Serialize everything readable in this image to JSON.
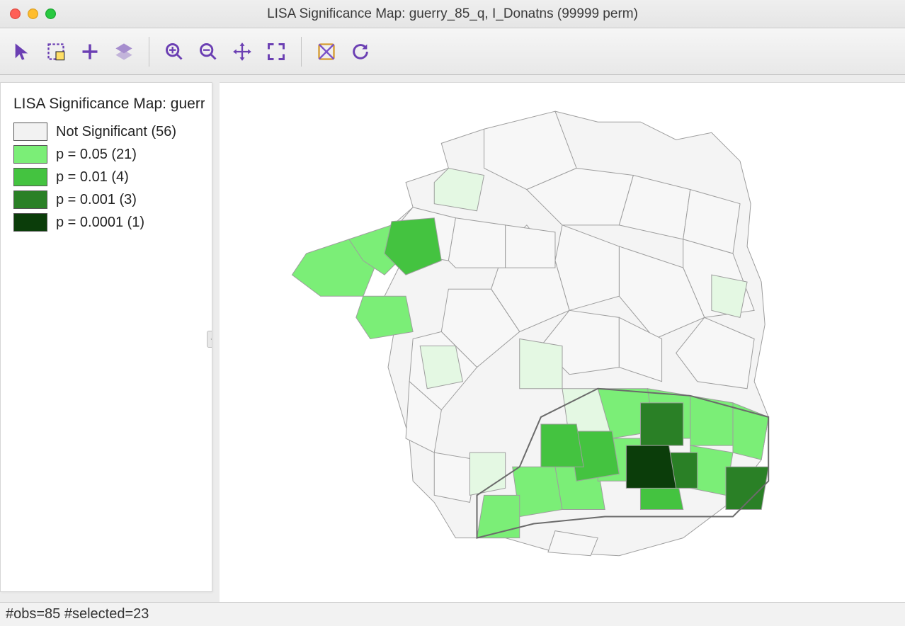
{
  "window": {
    "title": "LISA Significance Map: guerry_85_q, I_Donatns (99999 perm)"
  },
  "toolbar": {
    "items": [
      {
        "id": "pointer-tool",
        "icon": "pointer"
      },
      {
        "id": "select-tool",
        "icon": "select-rect"
      },
      {
        "id": "add-tool",
        "icon": "plus"
      },
      {
        "id": "layers-tool",
        "icon": "layers"
      },
      {
        "sep": true
      },
      {
        "id": "zoom-in-tool",
        "icon": "zoom-in"
      },
      {
        "id": "zoom-out-tool",
        "icon": "zoom-out"
      },
      {
        "id": "pan-tool",
        "icon": "pan"
      },
      {
        "id": "extent-tool",
        "icon": "extent"
      },
      {
        "sep": true
      },
      {
        "id": "basemap-tool",
        "icon": "basemap"
      },
      {
        "id": "refresh-tool",
        "icon": "refresh"
      }
    ]
  },
  "legend": {
    "title": "LISA Significance Map: guerry_85_q, I_Donatns (99999 perm)",
    "categories": [
      {
        "label": "Not Significant (56)",
        "color": "#f2f2f2",
        "count": 56
      },
      {
        "label": "p = 0.05 (21)",
        "color": "#7bee77",
        "count": 21
      },
      {
        "label": "p = 0.01 (4)",
        "color": "#44c340",
        "count": 4
      },
      {
        "label": "p = 0.001 (3)",
        "color": "#2a8026",
        "count": 3
      },
      {
        "label": "p = 0.0001 (1)",
        "color": "#0b3d0a",
        "count": 1
      }
    ]
  },
  "map": {
    "description": "Choropleth of French departments colored by LISA significance level",
    "palette": {
      "not_sig": "#f2f2f2",
      "p05": "#7bee77",
      "p01": "#44c340",
      "p001": "#2a8026",
      "p0001": "#0b3d0a"
    }
  },
  "status": {
    "text": "#obs=85 #selected=23",
    "obs": 85,
    "selected": 23
  }
}
